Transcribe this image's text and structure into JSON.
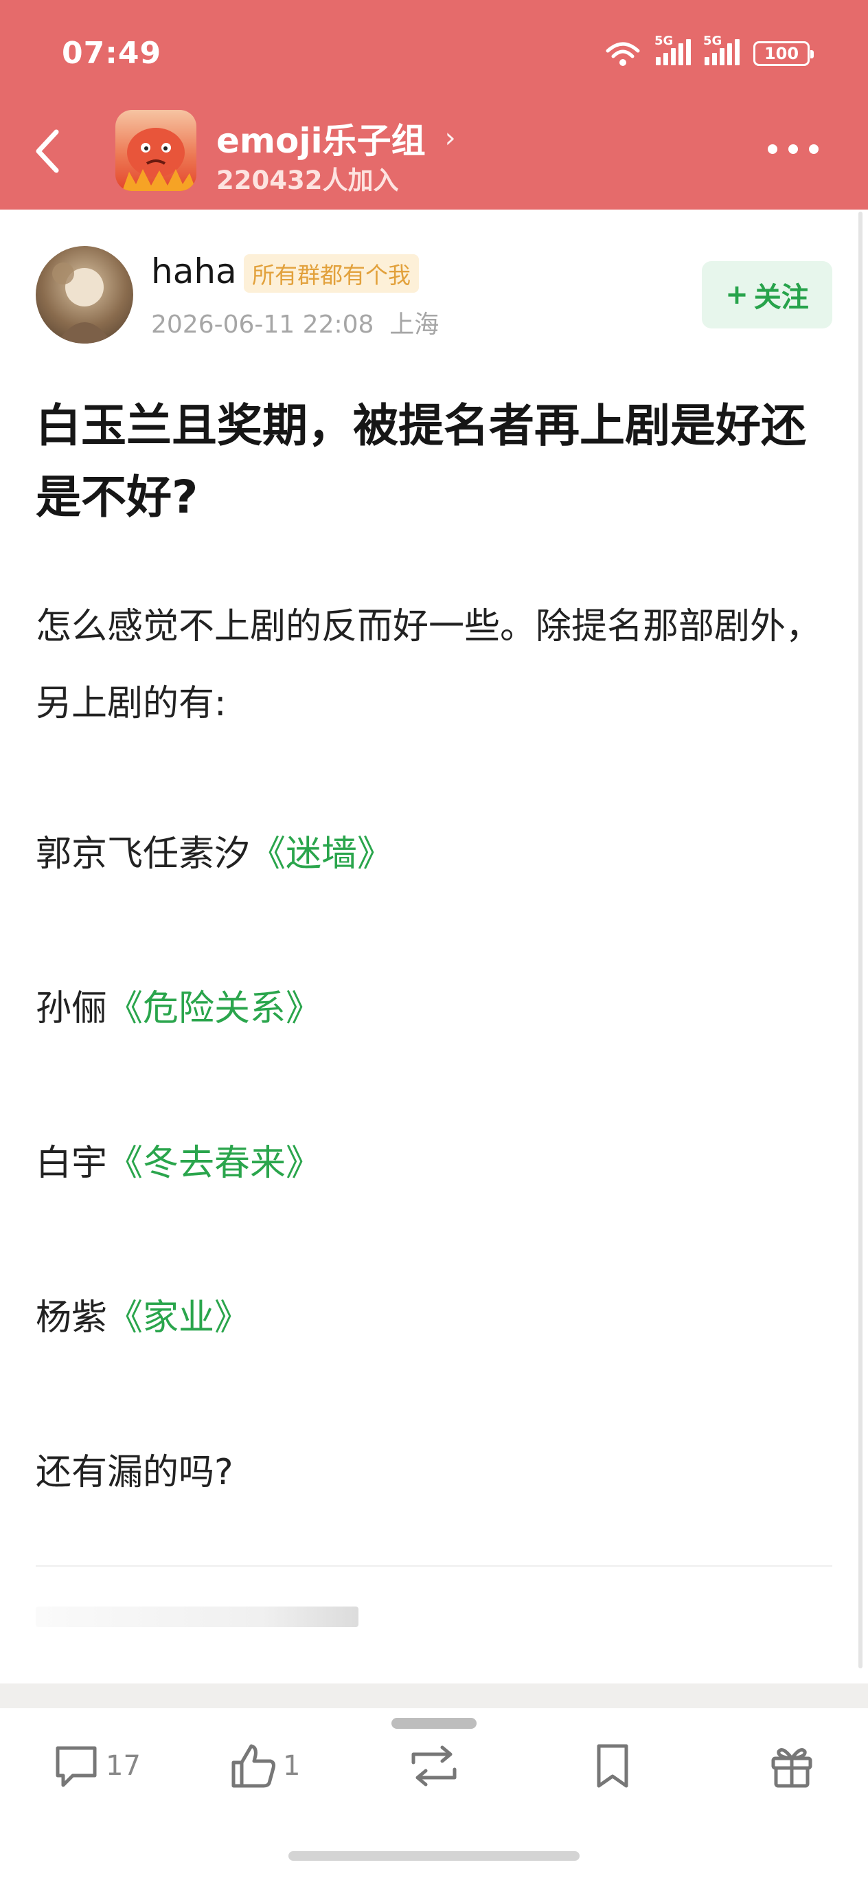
{
  "status": {
    "time": "07:49",
    "net1": "5G",
    "net2": "5G",
    "battery": "100"
  },
  "header": {
    "group_name": "emoji乐子组",
    "member_count": "220432人加入"
  },
  "post": {
    "username": "haha",
    "user_tag": "所有群都有个我",
    "datetime": "2026-06-11 22:08",
    "location": "上海",
    "follow_label": "关注",
    "title": "白玉兰且奖期，被提名者再上剧是好还是不好?",
    "intro": "怎么感觉不上剧的反而好一些。除提名那部剧外，另上剧的有:",
    "entries": [
      {
        "people": "郭京飞任素汐",
        "work": "《迷墙》"
      },
      {
        "people": "孙俪",
        "work": "《危险关系》"
      },
      {
        "people": "白宇",
        "work": "《冬去春来》"
      },
      {
        "people": "杨紫",
        "work": "《家业》"
      }
    ],
    "closing": "还有漏的吗?"
  },
  "actions": {
    "comments": "17",
    "likes": "1"
  },
  "colors": {
    "header_bg": "#e56b6b",
    "link_green": "#2aa54c",
    "tag_orange": "#e2a13c"
  }
}
